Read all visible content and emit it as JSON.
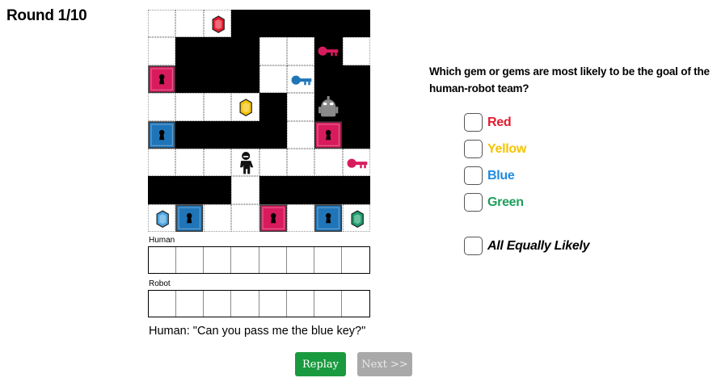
{
  "round": {
    "label": "Round 1/10"
  },
  "board": {
    "cols": 8,
    "rows": 8,
    "layout": [
      "...#####",
      ".###..#.",
      ".###..##",
      "....#.##",
      ".####.##",
      "........",
      "###.####",
      "........"
    ],
    "items": [
      {
        "kind": "gem",
        "row": 0,
        "col": 2,
        "color": "#e31b2e",
        "name": "red-gem-icon"
      },
      {
        "kind": "key",
        "row": 1,
        "col": 6,
        "color": "#d81b5d",
        "name": "pink-key-icon"
      },
      {
        "kind": "door",
        "row": 2,
        "col": 0,
        "color": "#d81b5d",
        "name": "pink-door-icon"
      },
      {
        "kind": "key",
        "row": 2,
        "col": 5,
        "color": "#1f75b8",
        "name": "blue-key-icon"
      },
      {
        "kind": "gem",
        "row": 3,
        "col": 3,
        "color": "#f5c400",
        "name": "yellow-gem-icon"
      },
      {
        "kind": "robot",
        "row": 3,
        "col": 6,
        "color": "#8a8a8a",
        "name": "robot-icon"
      },
      {
        "kind": "door",
        "row": 4,
        "col": 0,
        "color": "#1f75b8",
        "name": "blue-door-icon"
      },
      {
        "kind": "door",
        "row": 4,
        "col": 6,
        "color": "#d81b5d",
        "name": "pink-door-icon"
      },
      {
        "kind": "human",
        "row": 5,
        "col": 3,
        "color": "#111111",
        "name": "human-icon"
      },
      {
        "kind": "key",
        "row": 5,
        "col": 7,
        "color": "#d81b5d",
        "name": "pink-key-icon"
      },
      {
        "kind": "gem",
        "row": 7,
        "col": 0,
        "color": "#4aa3df",
        "name": "blue-gem-icon"
      },
      {
        "kind": "door",
        "row": 7,
        "col": 1,
        "color": "#1f75b8",
        "name": "blue-door-icon"
      },
      {
        "kind": "door",
        "row": 7,
        "col": 4,
        "color": "#d81b5d",
        "name": "pink-door-icon"
      },
      {
        "kind": "door",
        "row": 7,
        "col": 6,
        "color": "#1f75b8",
        "name": "blue-door-icon"
      },
      {
        "kind": "gem",
        "row": 7,
        "col": 7,
        "color": "#1b9e6b",
        "name": "green-gem-icon"
      }
    ]
  },
  "inventory": {
    "human_label": "Human",
    "robot_label": "Robot",
    "slots": 8
  },
  "utterance": "Human: \"Can you pass me the blue key?\"",
  "buttons": {
    "replay": "Replay",
    "next": "Next >>"
  },
  "question": {
    "text": "Which gem or gems are most likely to be the goal of the human-robot team?",
    "options": [
      {
        "label": "Red",
        "color": "#e31b2e"
      },
      {
        "label": "Yellow",
        "color": "#f5c400"
      },
      {
        "label": "Blue",
        "color": "#1f8be0"
      },
      {
        "label": "Green",
        "color": "#1e9e5a"
      }
    ],
    "equal_label": "All Equally Likely"
  }
}
